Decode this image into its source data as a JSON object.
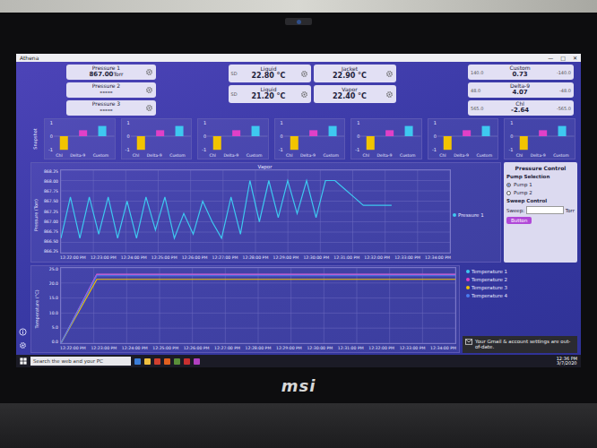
{
  "window": {
    "title": "Athena",
    "controls": [
      "—",
      "□",
      "✕"
    ]
  },
  "pressures": [
    {
      "label": "Pressure 1",
      "value": "867.00",
      "unit": "Torr"
    },
    {
      "label": "Pressure 2",
      "value": "-----"
    },
    {
      "label": "Pressure 3",
      "value": "-----"
    }
  ],
  "temperatures": [
    {
      "label": "Liquid",
      "value": "22.80",
      "unit": "°C",
      "tag": "SD"
    },
    {
      "label": "Jacket",
      "value": "22.90",
      "unit": "°C"
    },
    {
      "label": "Liquid",
      "value": "21.20",
      "unit": "°C",
      "tag": "SD"
    },
    {
      "label": "Vapor",
      "value": "22.40",
      "unit": "°C"
    }
  ],
  "customs": [
    {
      "label": "Custom",
      "value": "0.73",
      "min": "140.0",
      "max": "-140.0"
    },
    {
      "label": "Delta-9",
      "value": "4.07",
      "min": "48.0",
      "max": "-48.0"
    },
    {
      "label": "Chl",
      "value": "-2.64",
      "min": "565.0",
      "max": "-565.0"
    }
  ],
  "snapshot": {
    "title": "Snapshot",
    "ticks": [
      "1",
      "0",
      "-1"
    ],
    "series": [
      {
        "name": "Chl",
        "color": "#f2c400"
      },
      {
        "name": "Delta-9",
        "color": "#e040c8"
      },
      {
        "name": "Custom",
        "color": "#3ec8f0"
      }
    ],
    "panels": [
      [
        -0.8,
        0.35,
        0.6
      ],
      [
        -0.8,
        0.35,
        0.6
      ],
      [
        -0.8,
        0.35,
        0.6
      ],
      [
        -0.8,
        0.35,
        0.6
      ],
      [
        -0.8,
        0.35,
        0.6
      ],
      [
        -0.8,
        0.35,
        0.6
      ],
      [
        -0.8,
        0.35,
        0.6
      ]
    ]
  },
  "pressure_chart": {
    "title": "Vapor",
    "y_label": "Pressure (Torr)",
    "y_ticks": [
      "868.25",
      "868.00",
      "867.75",
      "867.50",
      "867.25",
      "867.00",
      "866.75",
      "866.50",
      "866.25"
    ],
    "x_ticks": [
      "12:22:00 PM",
      "12:23:00 PM",
      "12:24:00 PM",
      "12:25:00 PM",
      "12:26:00 PM",
      "12:27:00 PM",
      "12:28:00 PM",
      "12:29:00 PM",
      "12:30:00 PM",
      "12:31:00 PM",
      "12:32:00 PM",
      "12:33:00 PM",
      "12:34:00 PM"
    ],
    "series": [
      {
        "name": "Pressure 1",
        "color": "#3ec8f0",
        "values": [
          866.6,
          867.6,
          866.6,
          867.6,
          866.7,
          867.6,
          866.6,
          867.5,
          866.6,
          867.6,
          866.8,
          867.6,
          866.6,
          867.2,
          866.7,
          867.5,
          867.0,
          866.6,
          867.6,
          866.7,
          868.0,
          867.0,
          868.0,
          867.1,
          868.0,
          867.2,
          868.0,
          867.1,
          868.0,
          868.0,
          867.8,
          867.6,
          867.4,
          867.4,
          867.4,
          867.4
        ]
      }
    ]
  },
  "pressure_control": {
    "title": "Pressure Control",
    "pump_label": "Pump Selection",
    "pumps": [
      {
        "label": "Pump 1",
        "selected": true
      },
      {
        "label": "Pump 2",
        "selected": false
      }
    ],
    "sweep_label": "Sweep Control",
    "sweep_field": "Sweep:",
    "sweep_unit": "Torr",
    "button": "Button"
  },
  "temperature_chart": {
    "y_label": "Temperature (°C)",
    "y_ticks": [
      "25.0",
      "20.0",
      "15.0",
      "10.0",
      "5.0",
      "0.0"
    ],
    "x_ticks": [
      "12:22:00 PM",
      "12:23:00 PM",
      "12:24:00 PM",
      "12:25:00 PM",
      "12:26:00 PM",
      "12:27:00 PM",
      "12:28:00 PM",
      "12:29:00 PM",
      "12:30:00 PM",
      "12:31:00 PM",
      "12:32:00 PM",
      "12:33:00 PM",
      "12:34:00 PM"
    ],
    "series": [
      {
        "name": "Temperature 1",
        "color": "#3ec8f0",
        "values": [
          0,
          22.8,
          22.8,
          22.8,
          22.8,
          22.8,
          22.8,
          22.8,
          22.8,
          22.8,
          22.8,
          22.8
        ]
      },
      {
        "name": "Temperature 2",
        "color": "#e040c8",
        "values": [
          0,
          22.9,
          22.9,
          22.9,
          22.9,
          22.9,
          22.9,
          22.9,
          22.9,
          22.9,
          22.9,
          22.9
        ]
      },
      {
        "name": "Temperature 3",
        "color": "#f2c400",
        "values": [
          0,
          21.2,
          21.2,
          21.2,
          21.2,
          21.2,
          21.2,
          21.2,
          21.2,
          21.2,
          21.2,
          21.2
        ]
      },
      {
        "name": "Temperature 4",
        "color": "#4a7cf0",
        "values": [
          0,
          22.4,
          22.4,
          22.4,
          22.4,
          22.4,
          22.4,
          22.4,
          22.4,
          22.4,
          22.4,
          22.4
        ]
      }
    ]
  },
  "notification": {
    "text": "Your Gmail & account settings are out-of-date."
  },
  "taskbar": {
    "search": "Search the web and your PC",
    "time": "12:36 PM",
    "date": "3/7/2020"
  },
  "laptop": {
    "brand": "msi"
  }
}
